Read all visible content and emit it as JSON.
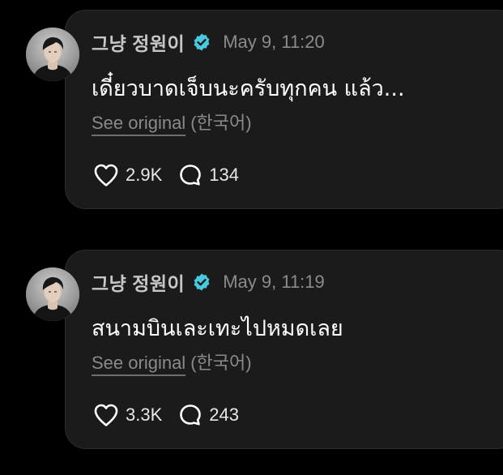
{
  "posts": [
    {
      "author": "그냥 정원이",
      "timestamp": "May 9, 11:20",
      "text": "เดี๋ยวบาดเจ็บนะครับทุกคน แล้ว...",
      "see_original": "See original",
      "language": "(한국어)",
      "likes": "2.9K",
      "comments": "134"
    },
    {
      "author": "그냥 정원이",
      "timestamp": "May 9, 11:19",
      "text": "สนามบินเละเทะไปหมดเลย",
      "see_original": "See original",
      "language": "(한국어)",
      "likes": "3.3K",
      "comments": "243"
    }
  ],
  "icons": {
    "verified": "verified-badge-icon",
    "like": "heart-icon",
    "comment": "speech-bubble-icon"
  },
  "colors": {
    "background": "#000000",
    "card": "#1b1b1b",
    "verified": "#4ac8e0",
    "muted_text": "#8c8c8c"
  }
}
